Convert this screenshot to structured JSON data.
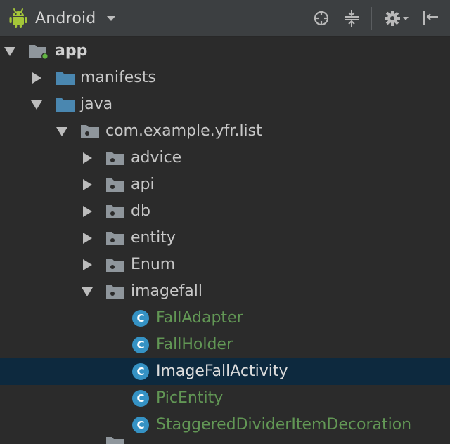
{
  "toolbar": {
    "view_label": "Android",
    "icons": [
      "android-icon",
      "locate-icon",
      "collapse-icon",
      "gear-icon",
      "hide-icon"
    ]
  },
  "colors": {
    "background": "#2b2b2b",
    "toolbar": "#3c3f41",
    "selection": "#0d293e",
    "folder_blue": "#4a87b0",
    "package_grey": "#8f969c",
    "class_badge": "#3592c4",
    "modified_green": "#629755",
    "android_green": "#a4c639"
  },
  "tree": {
    "app": "app",
    "manifests": "manifests",
    "java": "java",
    "package": "com.example.yfr.list",
    "advice": "advice",
    "api": "api",
    "db": "db",
    "entity": "entity",
    "enum": "Enum",
    "imagefall": "imagefall",
    "class_badge_letter": "C",
    "classes": {
      "fall_adapter": "FallAdapter",
      "fall_holder": "FallHolder",
      "image_fall_activity": "ImageFallActivity",
      "pic_entity": "PicEntity",
      "staggered": "StaggeredDividerItemDecoration"
    },
    "selected": "ImageFallActivity"
  }
}
